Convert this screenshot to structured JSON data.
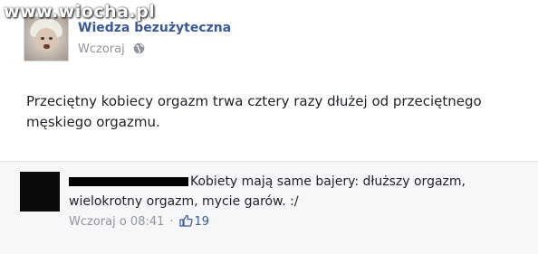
{
  "watermark": "www.wiocha.pl",
  "post": {
    "page_name": "Wiedza bezużyteczna",
    "time": "Wczoraj",
    "text": "Przeciętny kobiecy orgazm trwa cztery razy dłużej od przeciętnego męskiego orgazmu."
  },
  "comment": {
    "text": "Kobiety mają same bajery: dłuższy orgazm, wielokrotny orgazm, mycie garów. :/",
    "time": "Wczoraj o 08:41",
    "separator": "·",
    "likes": "19"
  },
  "icons": {
    "privacy": "globe-icon",
    "like": "thumbs-up-icon"
  },
  "colors": {
    "link": "#3b5998",
    "meta": "#90949c",
    "comment_bg": "#f6f7f9"
  }
}
